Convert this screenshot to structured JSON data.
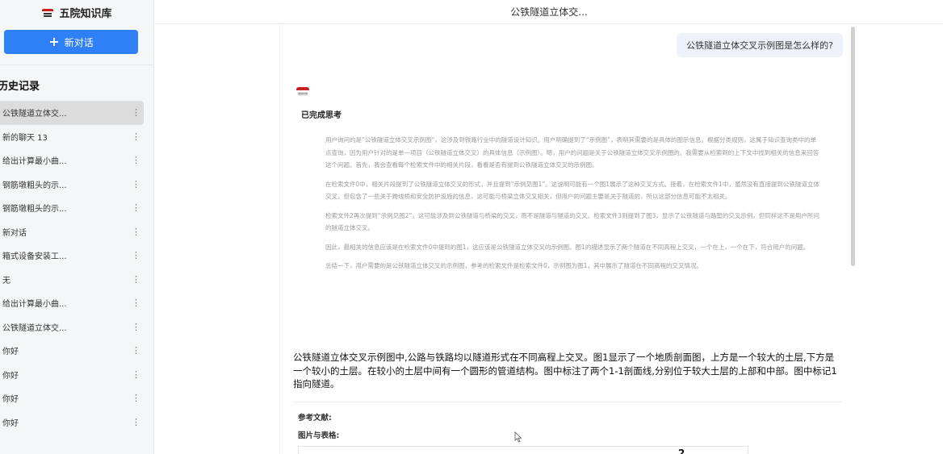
{
  "sidebar": {
    "brand_title": "五院知识库",
    "new_chat_label": "新对话",
    "history_heading": "历史记录",
    "items": [
      {
        "label": "公铁隧道立体交..."
      },
      {
        "label": "新的聊天 13"
      },
      {
        "label": "给出计算最小曲..."
      },
      {
        "label": "钢筋墩粗头的示..."
      },
      {
        "label": "钢筋墩粗头的示..."
      },
      {
        "label": "新对话"
      },
      {
        "label": "箱式设备安装工..."
      },
      {
        "label": "无"
      },
      {
        "label": "给出计算最小曲..."
      },
      {
        "label": "公铁隧道立体交..."
      },
      {
        "label": "你好"
      },
      {
        "label": "你好"
      },
      {
        "label": "你好"
      },
      {
        "label": "你好"
      }
    ]
  },
  "header": {
    "title": "公铁隧道立体交..."
  },
  "chat": {
    "user_message": "公铁隧道立体交叉示例图是怎么样的?",
    "thinking_status": "已完成思考",
    "thoughts": [
      "用户询问的是“公铁隧道立体交叉示例图”，这涉及到铁路行业中的隧道设计知识。用户明确提到了“示例图”，表明其需要的是具体的图示信息。根据分类规则，这属于知识查询类中的单点查询，因为用户针对的是单一项目（公铁隧道立体交叉）的具体信息（示例图）。嗯，用户的问题是关于公铁隧道立体交叉示例图的。我需要从检索到的上下文中找到相关的信息来回答这个问题。首先，我会查看每个检索文件中的相关片段，看看是否有提到公铁隧道立体交叉的示例图。",
      "在检索文件0中，相关片段提到了公铁隧道立体交叉的形式，并且提到“示例见图1”。这说明可能有一个图1展示了这种交叉方式。接着，在检索文件1中，虽然没有直接提到公铁隧道立体交叉，但包含了一些关于跨线桥和安全防护设施的信息，这可能与桥梁立体交叉相关，但用户的问题主要是关于隧道的，所以这部分信息可能不太相关。",
      "检索文件2再次提到“示例见图2”，这可能涉及到公铁隧道与桥梁的交叉，而不是隧道与隧道的交叉。检索文件3则提到了图3，显示了公铁隧道与路堑的交叉示例，但同样这不是用户所问的隧道立体交叉。",
      "因此，最相关的信息应该是在检索文件0中提到的图1，这应该是公铁隧道立体交叉的示例图。图1的描述显示了两个隧道在不同高程上交叉，一个在上，一个在下，符合用户的问题。",
      "总结一下，用户需要的是公铁隧道立体交叉的示例图，参考的检索文件是检索文件0，示例图为图1，其中展示了隧道在不同高程的交叉情况。"
    ],
    "answer": "公铁隧道立体交叉示例图中,公路与铁路均以隧道形式在不同高程上交叉。图1显示了一个地质剖面图，上方是一个较大的土层,下方是一个较小的土层。在较小的土层中间有一个圆形的管道结构。图中标注了两个1-1剖面线,分别位于较大土层的上部和中部。图中标记1指向隧道。",
    "references_label": "参考文献:",
    "figures_label": "图片与表格:",
    "figure_number": "2"
  },
  "colors": {
    "accent": "#2f7ff6",
    "brand_red": "#c8201e",
    "user_bubble": "#eef3fb",
    "sidebar_bg": "#f5f6f7"
  },
  "icons": {
    "new_chat": "plus-icon",
    "item_menu": "more-vertical-icon",
    "brand": "logo-icon",
    "bot": "bot-avatar-icon"
  }
}
